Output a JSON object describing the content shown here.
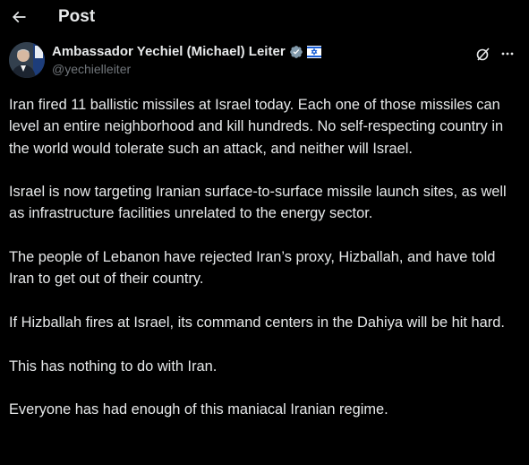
{
  "header": {
    "title": "Post"
  },
  "author": {
    "display_name": "Ambassador Yechiel (Michael) Leiter",
    "handle": "@yechielleiter",
    "verified_badge_color": "#829aab",
    "affiliation_badge": "flag-of-israel-icon"
  },
  "post": {
    "paragraphs": [
      "Iran fired 11 ballistic missiles at Israel today. Each one of those missiles can level an entire neighborhood and kill hundreds. No self-respecting country in the world would tolerate such an attack, and neither will Israel.",
      "Israel is now targeting Iranian surface-to-surface missile launch sites, as well as infrastructure facilities unrelated to the energy sector.",
      "The people of Lebanon have rejected Iran’s proxy, Hizballah, and have told Iran to get out of their country.",
      "If Hizballah fires at Israel, its command centers in the Dahiya will be hit hard.",
      "This has nothing to do with Iran.",
      "Everyone has had enough of this maniacal Iranian regime."
    ]
  },
  "colors": {
    "background": "#000000",
    "text": "#e7e9ea",
    "secondary_text": "#71767b"
  }
}
